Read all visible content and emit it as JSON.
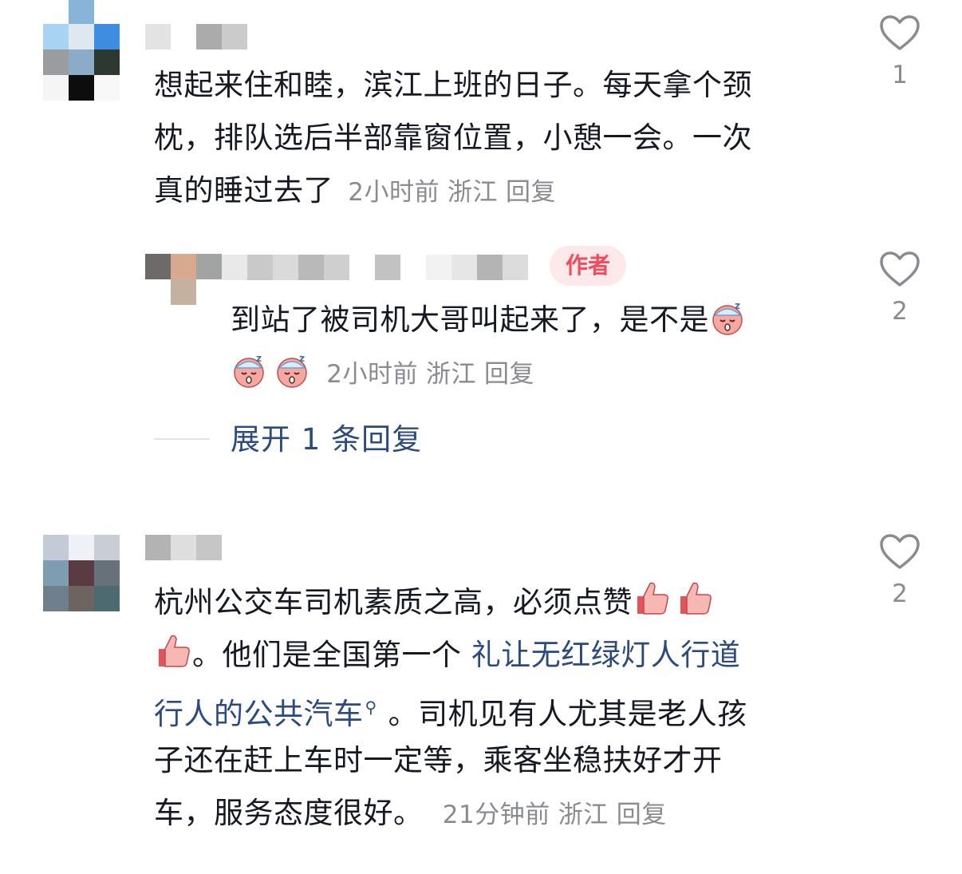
{
  "comments": [
    {
      "text_line1": "想起来住和睦，滨江上班的日子。每天拿个颈",
      "text_line2": "枕，排队选后半部靠窗位置，小憩一会。一次",
      "text_line3": "真的睡过去了",
      "time": "2小时前",
      "location": "浙江",
      "reply_label": "回复",
      "likes": "1",
      "reply": {
        "badge": "作者",
        "text_line1": "到站了被司机大哥叫起来了，是不是",
        "time": "2小时前",
        "location": "浙江",
        "reply_label": "回复",
        "likes": "2",
        "emojis": [
          "sleeping-face",
          "sleeping-face",
          "sleeping-face"
        ]
      },
      "expand_label": "展开 1 条回复"
    },
    {
      "text_line1": "杭州公交车司机素质之高，必须点赞",
      "text_line2_suffix": "。他们是全国第一个 ",
      "topic_part1": "礼让无红绿灯人行道",
      "topic_part2": "行人的公共汽车",
      "text_line3_suffix": "。司机见有人尤其是老人孩",
      "text_line4": "子还在赶上车时一定等，乘客坐稳扶好才开",
      "text_line5": "车，服务态度很好。",
      "time": "21分钟前",
      "location": "浙江",
      "reply_label": "回复",
      "likes": "2",
      "emojis": [
        "thumbs-up",
        "thumbs-up",
        "thumbs-up"
      ]
    }
  ],
  "colors": {
    "text": "#161823",
    "meta": "#8a8b91",
    "link": "#2b4a7e",
    "badge_bg": "#fde8ea",
    "badge_text": "#f24a5e"
  }
}
